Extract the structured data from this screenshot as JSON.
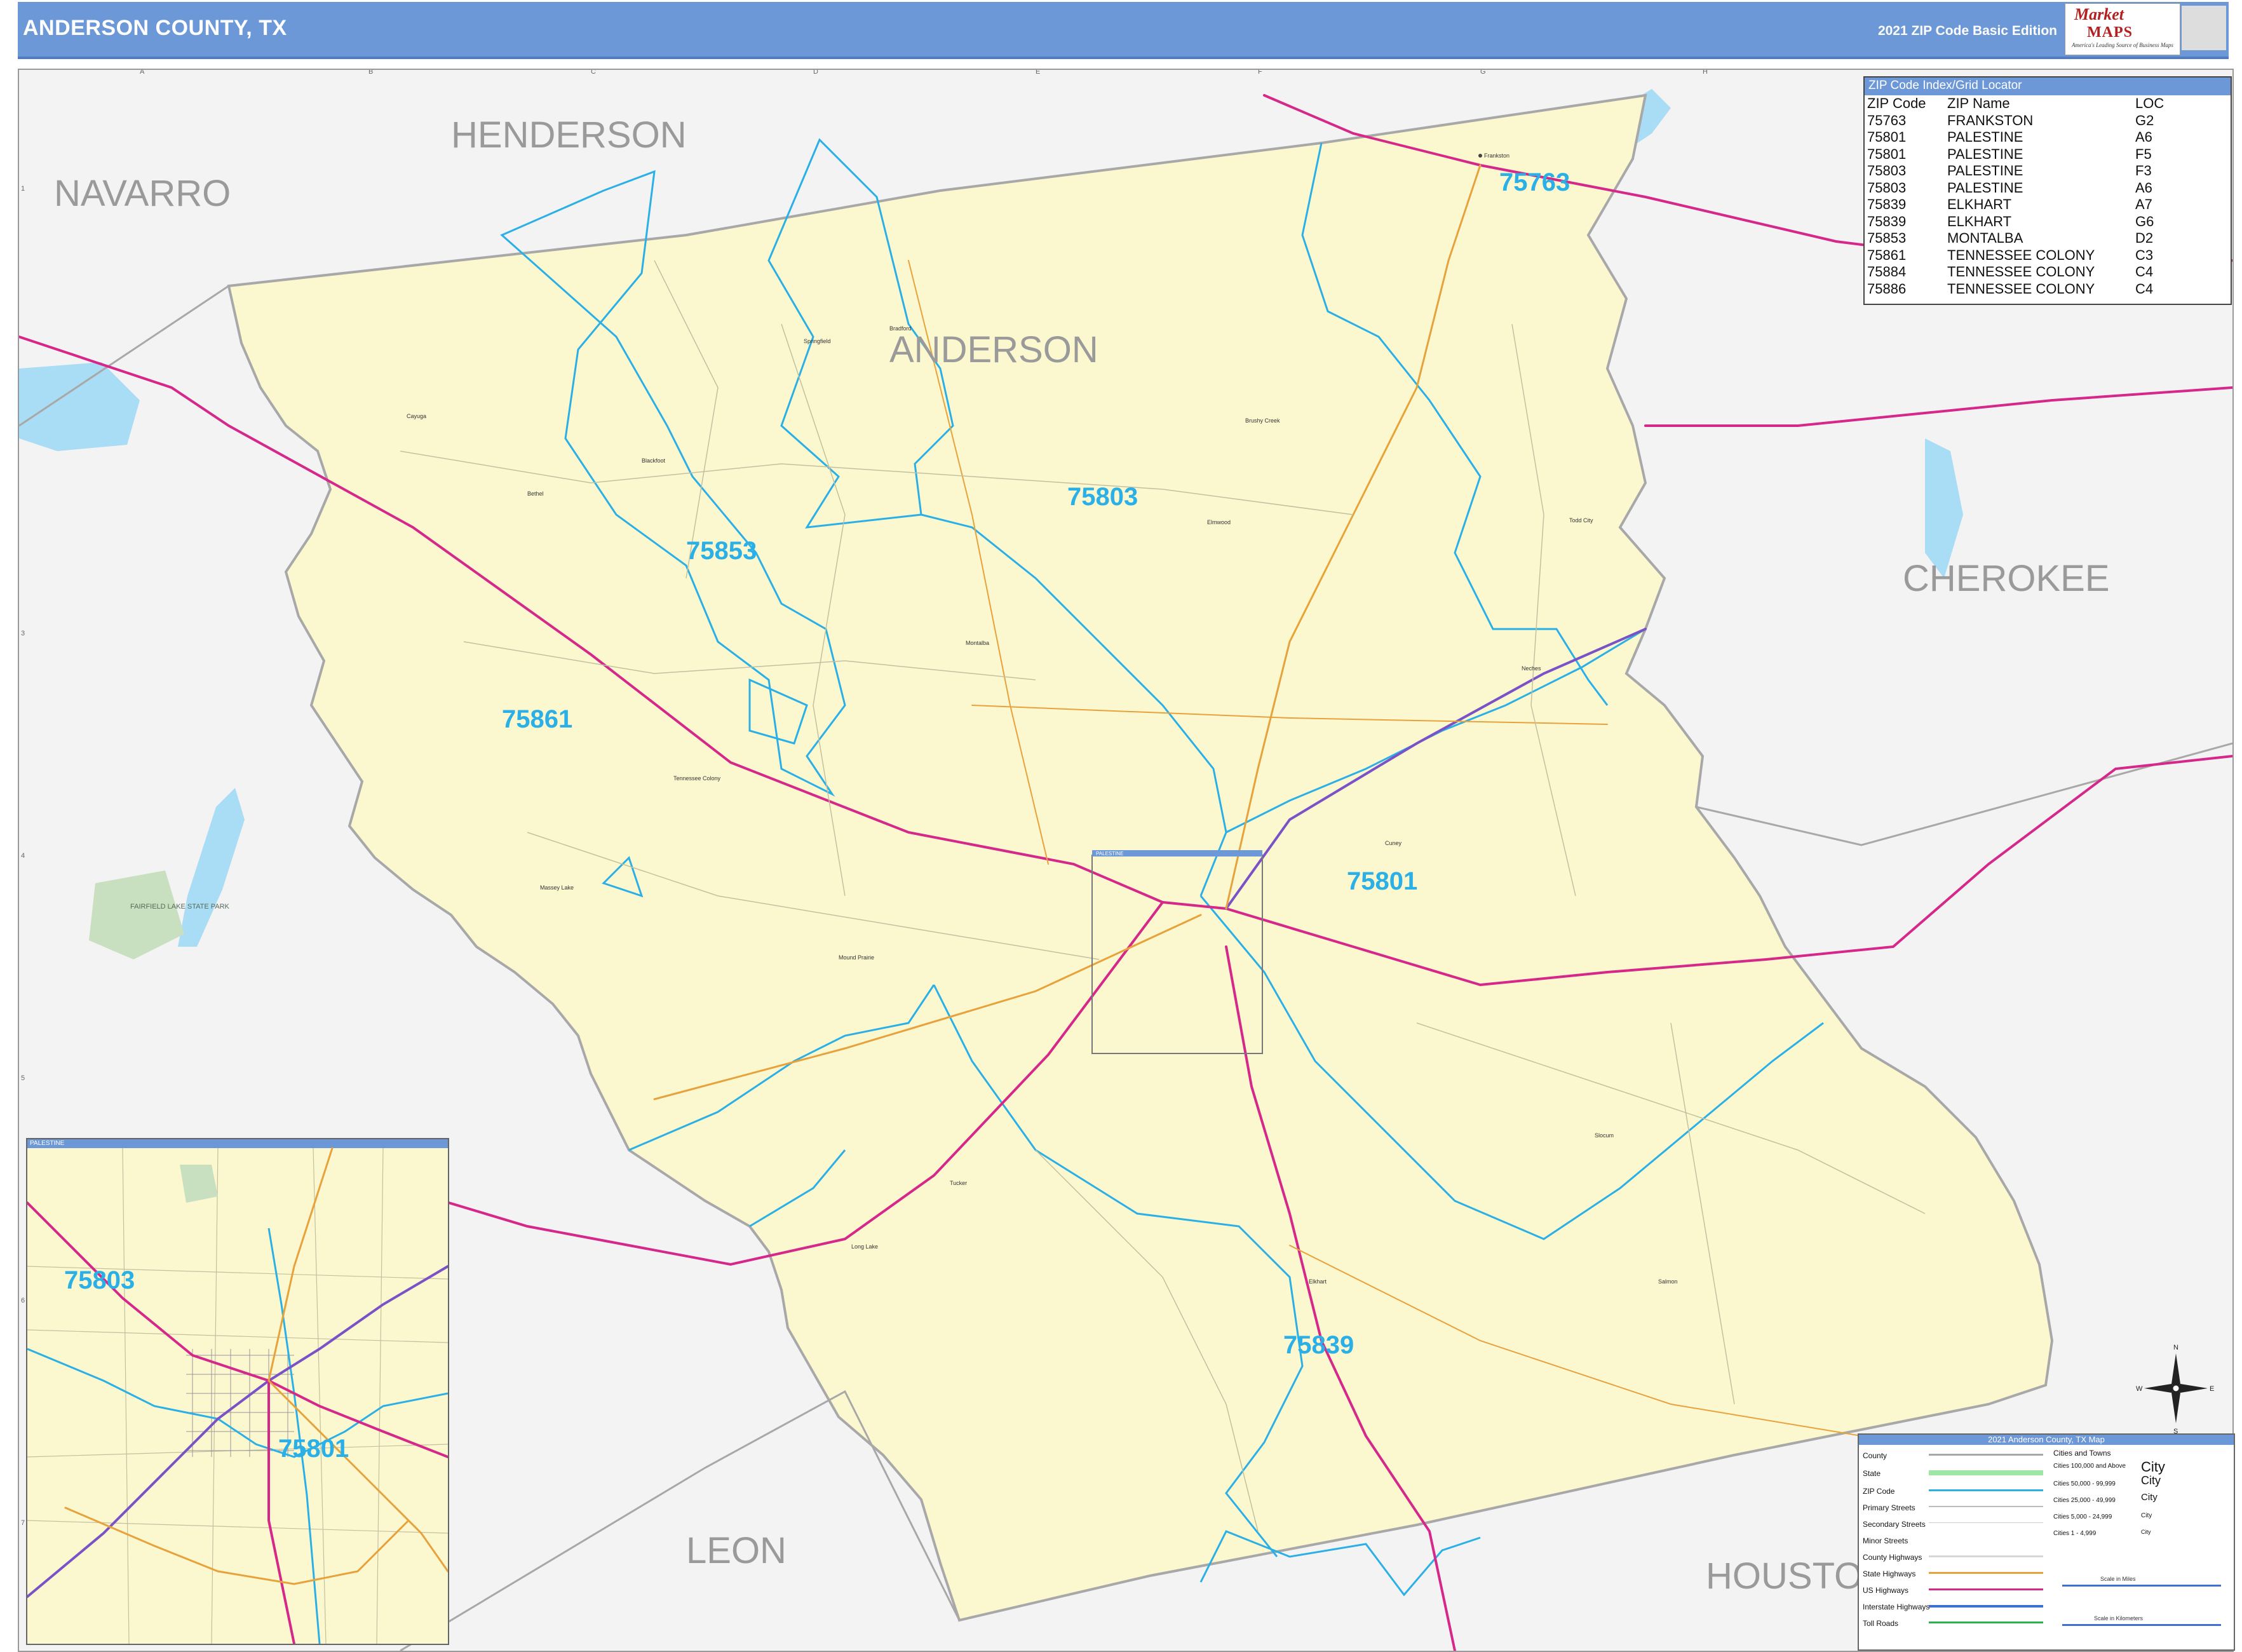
{
  "header": {
    "title": "ANDERSON COUNTY, TX",
    "edition": "2021 ZIP Code Basic Edition",
    "logo": {
      "line1": "Market",
      "line2": "MAPS",
      "tagline": "America's Leading Source of Business Maps"
    }
  },
  "colors": {
    "header_bg": "#6c98d8",
    "county_fill": "#fbf7cf",
    "outside_fill": "#f3f3f3",
    "zip_boundary": "#2ab0e6",
    "us_highway": "#d6278a",
    "state_highway": "#e8a23c",
    "county_border": "#a8a8a8",
    "water": "#a9dcf5"
  },
  "grid": {
    "columns": [
      "A",
      "B",
      "C",
      "D",
      "E",
      "F",
      "G",
      "H"
    ],
    "rows": [
      "1",
      "2",
      "3",
      "4",
      "5",
      "6",
      "7"
    ]
  },
  "counties": {
    "anderson": "ANDERSON",
    "henderson": "HENDERSON",
    "navarro": "NAVARRO",
    "cherokee": "CHEROKEE",
    "leon": "LEON",
    "houston": "HOUSTO"
  },
  "zip_labels": {
    "z75763": "75763",
    "z75803": "75803",
    "z75853": "75853",
    "z75861": "75861",
    "z75801": "75801",
    "z75839": "75839",
    "inset_75803": "75803",
    "inset_75801": "75801"
  },
  "places": {
    "frankston": "Frankston",
    "brushy_creek": "Brushy Creek",
    "springfield": "Springfield",
    "bradford": "Bradford",
    "cayuga": "Cayuga",
    "bethel": "Bethel",
    "blackfoot": "Blackfoot",
    "todd_city": "Todd City",
    "elmwood": "Elmwood",
    "neches": "Neches",
    "tennessee_colony": "Tennessee Colony",
    "massey_lake": "Massey Lake",
    "mound_prairie": "Mound Prairie",
    "slocum": "Slocum",
    "elkhart": "Elkhart",
    "tucker": "Tucker",
    "long_lake": "Long Lake",
    "cuney": "Cuney",
    "montalba": "Montalba",
    "salmon": "Salmon",
    "fairfield_park": "FAIRFIELD LAKE STATE PARK"
  },
  "inset": {
    "title": "PALESTINE",
    "main_frame_label": "PALESTINE"
  },
  "zip_index": {
    "title": "ZIP Code Index/Grid Locator",
    "headers": [
      "ZIP Code",
      "ZIP Name",
      "LOC"
    ],
    "rows": [
      [
        "75763",
        "FRANKSTON",
        "G2"
      ],
      [
        "75801",
        "PALESTINE",
        "A6"
      ],
      [
        "75801",
        "PALESTINE",
        "F5"
      ],
      [
        "75803",
        "PALESTINE",
        "F3"
      ],
      [
        "75803",
        "PALESTINE",
        "A6"
      ],
      [
        "75839",
        "ELKHART",
        "A7"
      ],
      [
        "75839",
        "ELKHART",
        "G6"
      ],
      [
        "75853",
        "MONTALBA",
        "D2"
      ],
      [
        "75861",
        "TENNESSEE COLONY",
        "C3"
      ],
      [
        "75884",
        "TENNESSEE COLONY",
        "C4"
      ],
      [
        "75886",
        "TENNESSEE COLONY",
        "C4"
      ]
    ]
  },
  "legend": {
    "title": "2021 Anderson County, TX Map",
    "items": [
      "County",
      "State",
      "ZIP Code",
      "Primary Streets",
      "Secondary Streets",
      "Minor Streets",
      "County Highways",
      "State Highways",
      "US Highways",
      "Interstate Highways",
      "Toll Roads"
    ],
    "cities_title": "Cities and Towns",
    "city_classes": [
      "Cities 100,000 and Above",
      "Cities 50,000 - 99,999",
      "Cities 25,000 - 49,999",
      "Cities 5,000 - 24,999",
      "Cities 1 - 4,999"
    ],
    "city_word": "City",
    "scale_miles": "Scale in Miles",
    "scale_km": "Scale in Kilometers"
  },
  "compass": {
    "n": "N",
    "s": "S",
    "e": "E",
    "w": "W"
  }
}
